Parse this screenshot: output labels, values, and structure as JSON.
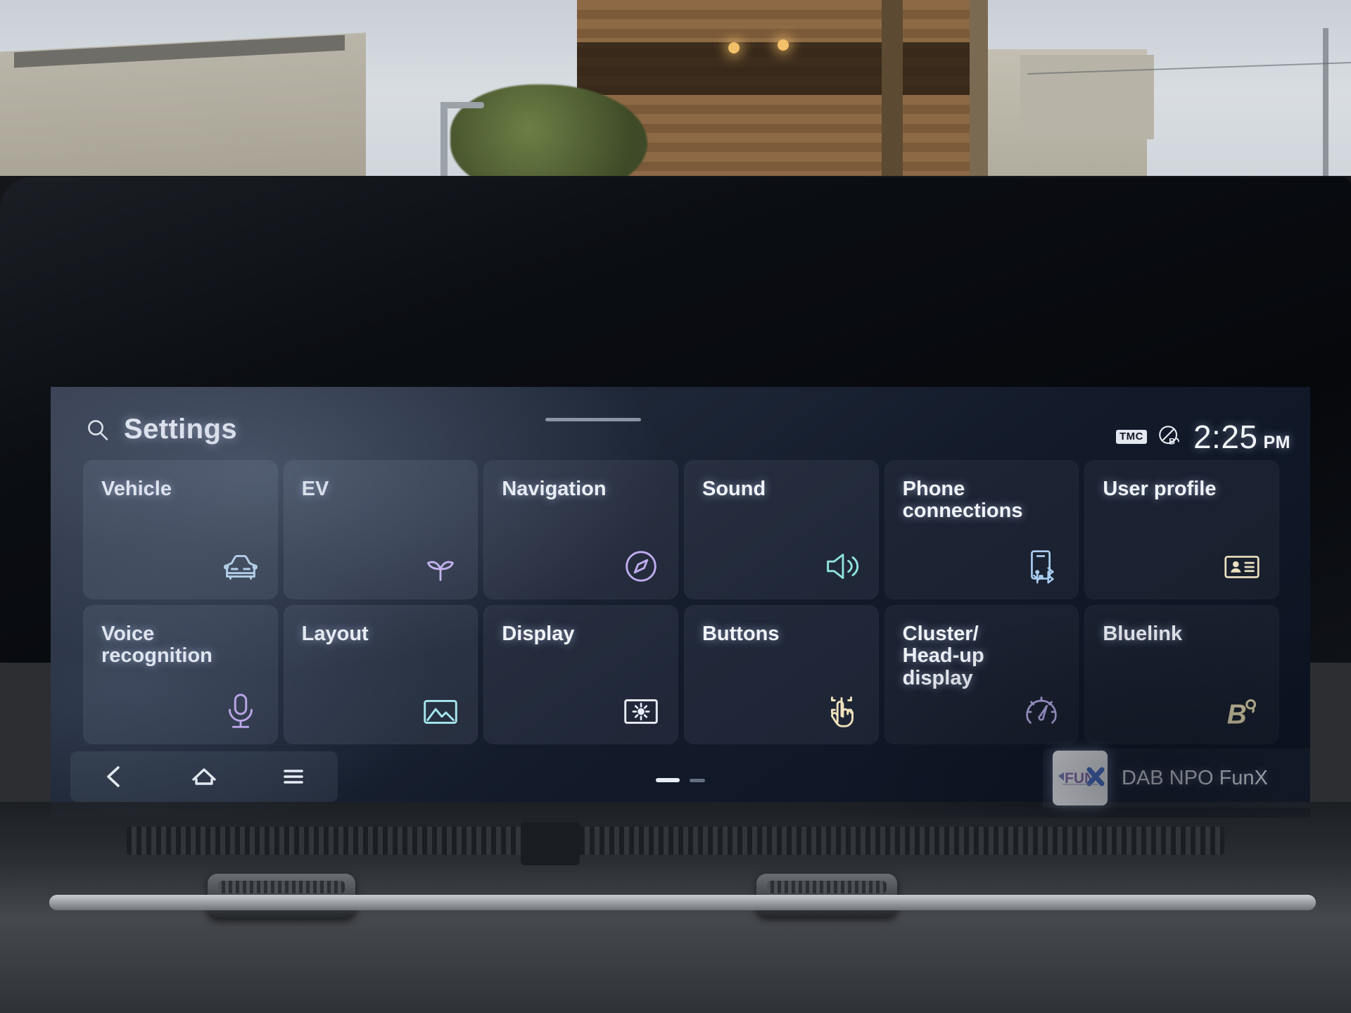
{
  "header": {
    "title": "Settings",
    "search_icon": "search-icon",
    "drag_handle": "drag-handle"
  },
  "status_bar": {
    "tmc_badge": "TMC",
    "bluelink_icon": "bluelink-status-icon",
    "time": "2:25",
    "ampm": "PM"
  },
  "tiles": [
    {
      "label": "Vehicle",
      "icon": "car-front-icon",
      "color": "#b9d7f0"
    },
    {
      "label": "EV",
      "icon": "leaf-sprout-icon",
      "color": "#c9b4f2"
    },
    {
      "label": "Navigation",
      "icon": "compass-icon",
      "color": "#c1abef"
    },
    {
      "label": "Sound",
      "icon": "speaker-volume-icon",
      "color": "#8fe3dd"
    },
    {
      "label": "Phone\nconnections",
      "icon": "phone-usb-bluetooth-icon",
      "color": "#a9cdf0"
    },
    {
      "label": "User profile",
      "icon": "id-card-icon",
      "color": "#ece0c0"
    },
    {
      "label": "Voice\nrecognition",
      "icon": "microphone-icon",
      "color": "#c4a8f0"
    },
    {
      "label": "Layout",
      "icon": "image-picture-icon",
      "color": "#a6e6ef"
    },
    {
      "label": "Display",
      "icon": "screen-brightness-icon",
      "color": "#e6eefb"
    },
    {
      "label": "Buttons",
      "icon": "hand-tap-button-icon",
      "color": "#f0e2bd"
    },
    {
      "label": "Cluster/\nHead-up\ndisplay",
      "icon": "speedometer-gauge-icon",
      "color": "#bdb2f0"
    },
    {
      "label": "Bluelink",
      "icon": "bluelink-b-icon",
      "color": "#ecdfb4"
    }
  ],
  "navbar": {
    "back": "back-chevron-icon",
    "home": "home-icon",
    "menu": "hamburger-menu-icon"
  },
  "pager": {
    "active_page": 1,
    "total_pages": 2
  },
  "media": {
    "station": "DAB NPO FunX",
    "artwork_label": "FUNX",
    "artwork_icon": "funx-station-logo"
  },
  "theme": {
    "screen_bg": "#131b2b",
    "tile_bg": "rgba(255,255,255,.045)",
    "text": "#f0f3f9"
  }
}
